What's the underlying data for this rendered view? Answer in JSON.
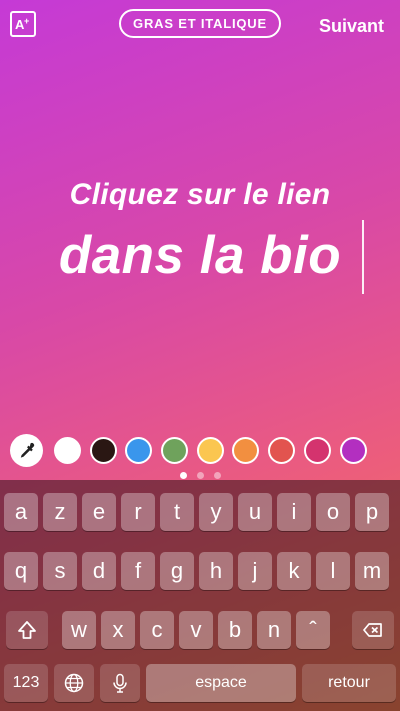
{
  "toolbar": {
    "font_icon": "text-size-icon",
    "style_label": "GRAS ET ITALIQUE",
    "next_label": "Suivant"
  },
  "canvas": {
    "line1": "Cliquez sur le lien",
    "line2": "dans la bio"
  },
  "colors": {
    "eyedropper_icon": "eyedropper-icon",
    "swatches": [
      "#ffffff",
      "#2a1713",
      "#3a96ec",
      "#6fa25c",
      "#fbc650",
      "#f28f40",
      "#e2544f",
      "#d4336e",
      "#b32fc0"
    ],
    "pages": 3,
    "active_page": 1
  },
  "keyboard": {
    "row1": [
      "a",
      "z",
      "e",
      "r",
      "t",
      "y",
      "u",
      "i",
      "o",
      "p"
    ],
    "row2": [
      "q",
      "s",
      "d",
      "f",
      "g",
      "h",
      "j",
      "k",
      "l",
      "m"
    ],
    "row3": [
      "w",
      "x",
      "c",
      "v",
      "b",
      "n",
      "ˆ"
    ],
    "shift_icon": "shift-icon",
    "delete_icon": "backspace-icon",
    "numbers_label": "123",
    "globe_icon": "globe-icon",
    "mic_icon": "microphone-icon",
    "space_label": "espace",
    "return_label": "retour"
  }
}
